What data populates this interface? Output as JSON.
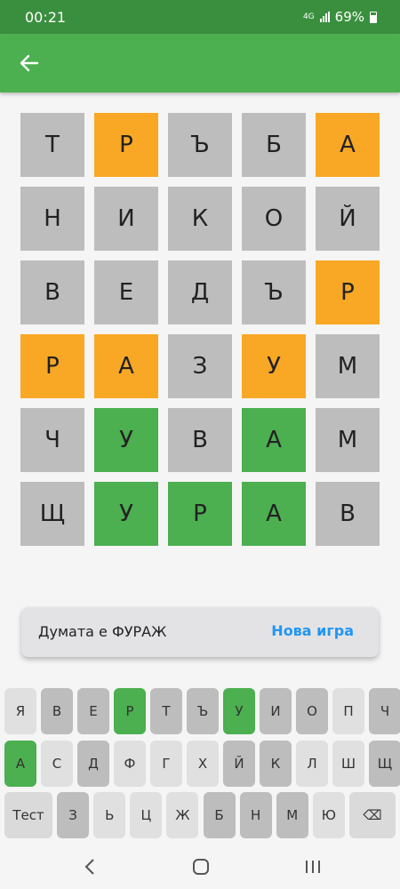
{
  "status": {
    "time": "00:21",
    "network": "4G",
    "battery": "69%"
  },
  "board": [
    [
      [
        "Т",
        "absent"
      ],
      [
        "Р",
        "present"
      ],
      [
        "Ъ",
        "absent"
      ],
      [
        "Б",
        "absent"
      ],
      [
        "А",
        "present"
      ]
    ],
    [
      [
        "Н",
        "absent"
      ],
      [
        "И",
        "absent"
      ],
      [
        "К",
        "absent"
      ],
      [
        "О",
        "absent"
      ],
      [
        "Й",
        "absent"
      ]
    ],
    [
      [
        "В",
        "absent"
      ],
      [
        "Е",
        "absent"
      ],
      [
        "Д",
        "absent"
      ],
      [
        "Ъ",
        "absent"
      ],
      [
        "Р",
        "present"
      ]
    ],
    [
      [
        "Р",
        "present"
      ],
      [
        "А",
        "present"
      ],
      [
        "З",
        "absent"
      ],
      [
        "У",
        "present"
      ],
      [
        "М",
        "absent"
      ]
    ],
    [
      [
        "Ч",
        "absent"
      ],
      [
        "У",
        "correct"
      ],
      [
        "В",
        "absent"
      ],
      [
        "А",
        "correct"
      ],
      [
        "М",
        "absent"
      ]
    ],
    [
      [
        "Щ",
        "absent"
      ],
      [
        "У",
        "correct"
      ],
      [
        "Р",
        "correct"
      ],
      [
        "А",
        "correct"
      ],
      [
        "В",
        "absent"
      ]
    ]
  ],
  "result": {
    "message": "Думата е ФУРАЖ",
    "new_game_label": "Нова игра"
  },
  "keyboard": {
    "row1": [
      [
        "Я",
        "unused"
      ],
      [
        "В",
        "absent"
      ],
      [
        "Е",
        "absent"
      ],
      [
        "Р",
        "correct"
      ],
      [
        "Т",
        "absent"
      ],
      [
        "Ъ",
        "absent"
      ],
      [
        "У",
        "correct"
      ],
      [
        "И",
        "absent"
      ],
      [
        "О",
        "absent"
      ],
      [
        "П",
        "unused"
      ],
      [
        "Ч",
        "absent"
      ]
    ],
    "row2": [
      [
        "А",
        "correct"
      ],
      [
        "С",
        "unused"
      ],
      [
        "Д",
        "absent"
      ],
      [
        "Ф",
        "unused"
      ],
      [
        "Г",
        "unused"
      ],
      [
        "Х",
        "unused"
      ],
      [
        "Й",
        "absent"
      ],
      [
        "К",
        "absent"
      ],
      [
        "Л",
        "unused"
      ],
      [
        "Ш",
        "unused"
      ],
      [
        "Щ",
        "absent"
      ]
    ],
    "row3": [
      [
        "Тест",
        "enter"
      ],
      [
        "З",
        "absent"
      ],
      [
        "Ь",
        "unused"
      ],
      [
        "Ц",
        "unused"
      ],
      [
        "Ж",
        "unused"
      ],
      [
        "Б",
        "absent"
      ],
      [
        "Н",
        "absent"
      ],
      [
        "М",
        "absent"
      ],
      [
        "Ю",
        "unused"
      ],
      [
        "⌫",
        "backspace"
      ]
    ]
  }
}
